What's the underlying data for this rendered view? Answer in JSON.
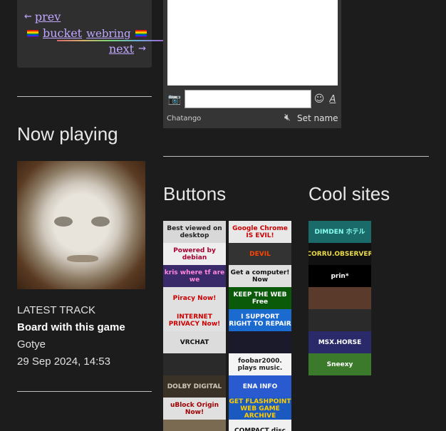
{
  "webring": {
    "prev": "prev",
    "prev_arrow": "⇜",
    "title_word1": "bucket",
    "title_word2": "webring",
    "next": "next",
    "next_arrow": "⇝"
  },
  "now_playing": {
    "heading": "Now playing",
    "label": "LATEST TRACK",
    "track": "Board with this game",
    "artist": "Gotye",
    "timestamp": "29 Sep 2024, 14:53"
  },
  "chat": {
    "brand": "Chatango",
    "set_name": "Set name",
    "format_icon": "A",
    "input_value": ""
  },
  "buttons_heading": "Buttons",
  "cool_sites_heading": "Cool sites",
  "buttons_left": [
    {
      "text": "Best viewed on desktop",
      "bg": "#d8d8d8",
      "fg": "#222222"
    },
    {
      "text": "Powered by debian",
      "bg": "#eeeeee",
      "fg": "#a80030"
    },
    {
      "text": "kris where tf are we",
      "bg": "#3a2a6a",
      "fg": "#ff88dd"
    },
    {
      "text": "Piracy Now!",
      "bg": "#e0e0e0",
      "fg": "#cc0000"
    },
    {
      "text": "INTERNET PRIVACY Now!",
      "bg": "#e0e0e0",
      "fg": "#cc0000"
    },
    {
      "text": "VRCHAT",
      "bg": "#dcdcdc",
      "fg": "#111111"
    },
    {
      "text": "",
      "bg": "#2a2a2a",
      "fg": "#d04bd0"
    },
    {
      "text": "DOLBY DIGITAL",
      "bg": "#3a3226",
      "fg": "#cfc8b8"
    },
    {
      "text": "uBlock Origin Now!",
      "bg": "#e0e0e0",
      "fg": "#a00000"
    },
    {
      "text": "",
      "bg": "#7a6a52",
      "fg": "#ffffff"
    }
  ],
  "buttons_right": [
    {
      "text": "Google Chrome IS EVIL!",
      "bg": "#e8e8e8",
      "fg": "#cc0000"
    },
    {
      "text": "DEVIL",
      "bg": "#333333",
      "fg": "#ff4400"
    },
    {
      "text": "Get a computer! Now",
      "bg": "#e0e0e0",
      "fg": "#111111"
    },
    {
      "text": "KEEP THE WEB Free",
      "bg": "#0a5a0a",
      "fg": "#ffffff"
    },
    {
      "text": "I SUPPORT RIGHT TO REPAIR",
      "bg": "#1a6ad0",
      "fg": "#ffffff"
    },
    {
      "text": "",
      "bg": "#1a1a2a",
      "fg": "#5a8aff"
    },
    {
      "text": "foobar2000. plays music.",
      "bg": "#f4f4f4",
      "fg": "#222222"
    },
    {
      "text": "ENA INFO",
      "bg": "#2a5ad0",
      "fg": "#ffffff"
    },
    {
      "text": "GET FLASHPOINT WEB GAME ARCHIVE",
      "bg": "#1a5ac0",
      "fg": "#ffcc00"
    },
    {
      "text": "COMPACT disc",
      "bg": "#f0f0f0",
      "fg": "#111111"
    }
  ],
  "cool_sites": [
    {
      "text": "DIMDEN ホテル",
      "bg": "#1a6a6a",
      "fg": "#88ffee"
    },
    {
      "text": "CORRU.OBSERVER",
      "bg": "#111111",
      "fg": "#eedd44"
    },
    {
      "text": "prin*",
      "bg": "#000000",
      "fg": "#ffffff"
    },
    {
      "text": "",
      "bg": "#5a3a2a",
      "fg": "#ffffff"
    },
    {
      "text": "",
      "bg": "#2a2a2a",
      "fg": "#ffffff"
    },
    {
      "text": "MSX.HORSE",
      "bg": "#2a2a6a",
      "fg": "#ffffff"
    },
    {
      "text": "Sneexy",
      "bg": "#3a7a2a",
      "fg": "#ffffff"
    }
  ]
}
